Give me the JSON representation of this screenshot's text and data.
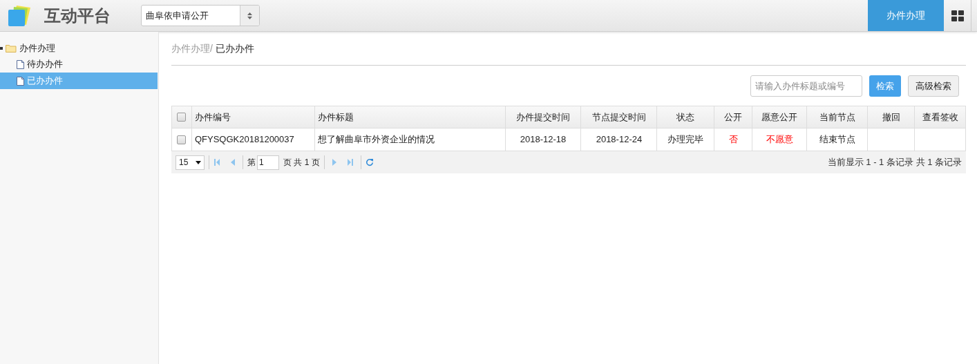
{
  "header": {
    "title": "互动平台",
    "selector": {
      "value": "曲阜依申请公开"
    },
    "nav": [
      {
        "label": "办件办理",
        "selected": true
      }
    ]
  },
  "sidebar": {
    "tree": [
      {
        "label": "办件办理",
        "expanded": true,
        "selected": false,
        "children": [
          {
            "label": "待办办件",
            "selected": false
          },
          {
            "label": "已办办件",
            "selected": true
          }
        ]
      }
    ]
  },
  "breadcrumb": {
    "parent": "办件办理/",
    "current": "已办办件"
  },
  "search": {
    "placeholder": "请输入办件标题或编号",
    "buttons": [
      {
        "label": "检索",
        "kind": "primary"
      },
      {
        "label": "高级检索",
        "kind": "default"
      }
    ]
  },
  "table": {
    "columns": [
      {
        "label": "办件编号"
      },
      {
        "label": "办件标题"
      },
      {
        "label": "办件提交时间"
      },
      {
        "label": "节点提交时间"
      },
      {
        "label": "状态"
      },
      {
        "label": "公开"
      },
      {
        "label": "愿意公开"
      },
      {
        "label": "当前节点"
      },
      {
        "label": "撤回"
      },
      {
        "label": "查看签收"
      }
    ],
    "header_checked": false,
    "rows": [
      {
        "checked": false,
        "cells": [
          {
            "text": "QFYSQGK20181200037"
          },
          {
            "text": "想了解曲阜市外资企业的情况"
          },
          {
            "text": "2018-12-18"
          },
          {
            "text": "2018-12-24"
          },
          {
            "text": "办理完毕"
          },
          {
            "text": "否",
            "kind": "warning"
          },
          {
            "text": "不愿意",
            "kind": "warning"
          },
          {
            "text": "结束节点"
          }
        ]
      }
    ]
  },
  "pager": {
    "page_size": "15",
    "page_prefix": "第",
    "page": "1",
    "page_suffix": "页 共 1 页",
    "summary": "当前显示 1 - 1 条记录 共 1 条记录"
  }
}
